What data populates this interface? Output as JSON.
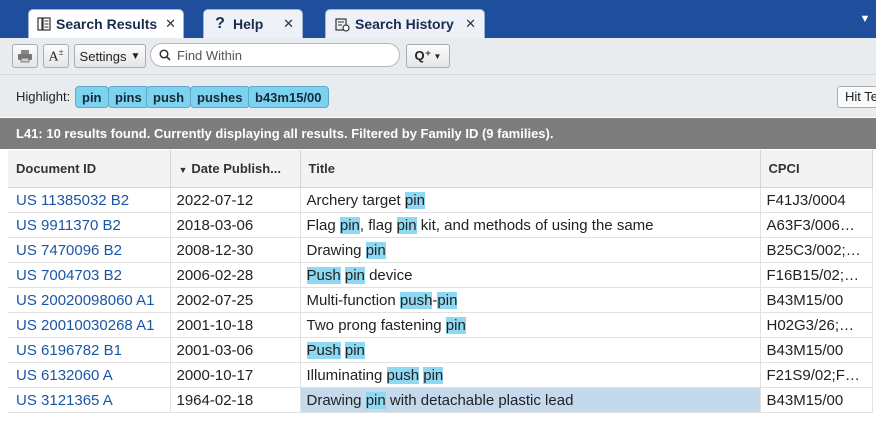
{
  "tabs": [
    {
      "label": "Search Results",
      "icon": "document-list-icon",
      "close": "✕"
    },
    {
      "label": "Help",
      "icon": "question-icon",
      "close": "✕"
    },
    {
      "label": "Search History",
      "icon": "history-icon",
      "close": "✕"
    }
  ],
  "tab_menu": "▼",
  "toolbar": {
    "print_icon": "print-icon",
    "font_icon": "font-size-icon",
    "settings_label": "Settings",
    "search_placeholder": "Find Within",
    "query_label": "Q⁺"
  },
  "highlight": {
    "label": "Highlight:",
    "terms": [
      "pin",
      "pins",
      "push",
      "pushes",
      "b43m15/00"
    ],
    "hit_text_label": "Hit Te"
  },
  "status": "L41: 10 results found. Currently displaying all results. Filtered by Family ID (9 families).",
  "table": {
    "columns": [
      "Document ID",
      "Date Publish...",
      "Title",
      "CPCI"
    ],
    "rows": [
      {
        "doc": "US 11385032 B2",
        "date": "2022-07-12",
        "title": "Archery target pin",
        "cpc": "F41J3/0004"
      },
      {
        "doc": "US 9911370 B2",
        "date": "2018-03-06",
        "title": "Flag pin, flag pin kit, and methods of using the same",
        "cpc": "A63F3/006…"
      },
      {
        "doc": "US 7470096 B2",
        "date": "2008-12-30",
        "title": "Drawing pin",
        "cpc": "B25C3/002;…"
      },
      {
        "doc": "US 7004703 B2",
        "date": "2006-02-28",
        "title": "Push pin device",
        "cpc": "F16B15/02;…"
      },
      {
        "doc": "US 20020098060 A1",
        "date": "2002-07-25",
        "title": "Multi-function push-pin",
        "cpc": "B43M15/00"
      },
      {
        "doc": "US 20010030268 A1",
        "date": "2001-10-18",
        "title": "Two prong fastening pin",
        "cpc": "H02G3/26;…"
      },
      {
        "doc": "US 6196782 B1",
        "date": "2001-03-06",
        "title": "Push pin",
        "cpc": "B43M15/00"
      },
      {
        "doc": "US 6132060 A",
        "date": "2000-10-17",
        "title": "Illuminating push pin",
        "cpc": "F21S9/02;F…"
      },
      {
        "doc": "US 3121365 A",
        "date": "1964-02-18",
        "title": "Drawing pin with detachable plastic lead",
        "cpc": "B43M15/00"
      }
    ]
  },
  "colors": {
    "tabbar": "#1f4e9c",
    "highlight": "#8fd8f2",
    "link": "#1a56a8",
    "selected": "#c5d9ec"
  }
}
